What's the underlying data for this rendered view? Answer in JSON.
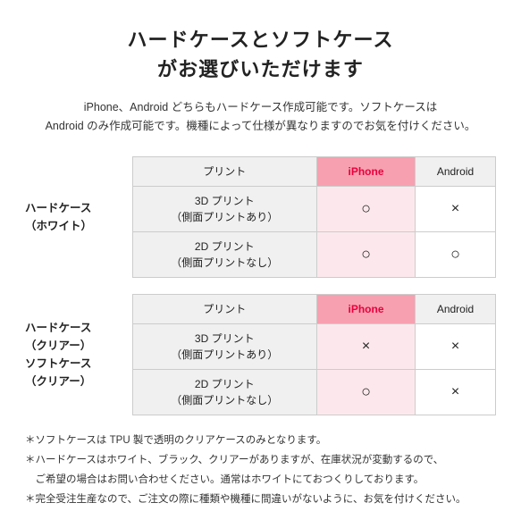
{
  "title": {
    "line1": "ハードケースとソフトケース",
    "line2": "がお選びいただけます"
  },
  "subtitle": "iPhone、Android どちらもハードケース作成可能です。ソフトケースは\nAndroid のみ作成可能です。機種によって仕様が異なりますのでお気を付けください。",
  "table1": {
    "row_label": "ハードケース\n（ホワイト）",
    "header_print": "プリント",
    "header_iphone": "iPhone",
    "header_android": "Android",
    "rows": [
      {
        "print": "3D プリント\n（側面プリントあり）",
        "iphone": "○",
        "android": "×"
      },
      {
        "print": "2D プリント\n（側面プリントなし）",
        "iphone": "○",
        "android": "○"
      }
    ]
  },
  "table2": {
    "row_label_line1": "ハードケース",
    "row_label_line2": "（クリアー）",
    "row_label2_line1": "ソフトケース",
    "row_label2_line2": "（クリアー）",
    "header_print": "プリント",
    "header_iphone": "iPhone",
    "header_android": "Android",
    "rows": [
      {
        "print": "3D プリント\n（側面プリントあり）",
        "iphone": "×",
        "android": "×"
      },
      {
        "print": "2D プリント\n（側面プリントなし）",
        "iphone": "○",
        "android": "×"
      }
    ]
  },
  "notes": [
    "＊ソフトケースは TPU 製で透明のクリアケースのみとなります。",
    "＊ハードケースはホワイト、ブラック、クリアーがありますが、在庫状況が変動するので、",
    "　ご希望の場合はお問い合わせください。通常はホワイトにておつくりしております。",
    "＊完全受注生産なので、ご注文の際に種類や機種に間違いがないように、お気を付けください。"
  ]
}
